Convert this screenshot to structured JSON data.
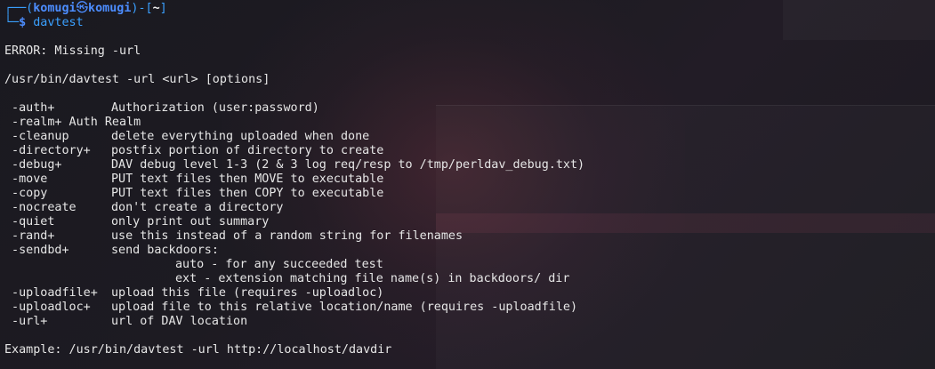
{
  "theme": {
    "background": "#1b1a20",
    "text": "#e6e6e6",
    "prompt_blue": "#3aa0ff",
    "prompt_user": "#4c8dff"
  },
  "prompt": {
    "frame_top_left": "┌──(",
    "user": "komugi",
    "skull_icon": "㉿",
    "host": "komugi",
    "frame_mid": ")-[",
    "cwd": "~",
    "frame_end": "]",
    "frame_bottom": "└─",
    "dollar": "$",
    "command": "davtest"
  },
  "output": {
    "error": "ERROR: Missing -url",
    "usage": "/usr/bin/davtest -url <url> [options]",
    "options": [
      {
        "flag": " -auth+",
        "desc": "Authorization (user:password)"
      },
      {
        "flag": " -realm+ Auth Realm",
        "desc": ""
      },
      {
        "flag": " -cleanup",
        "desc": "delete everything uploaded when done"
      },
      {
        "flag": " -directory+",
        "desc": "postfix portion of directory to create"
      },
      {
        "flag": " -debug+",
        "desc": "DAV debug level 1-3 (2 & 3 log req/resp to /tmp/perldav_debug.txt)"
      },
      {
        "flag": " -move",
        "desc": "PUT text files then MOVE to executable"
      },
      {
        "flag": " -copy",
        "desc": "PUT text files then COPY to executable"
      },
      {
        "flag": " -nocreate",
        "desc": "don't create a directory"
      },
      {
        "flag": " -quiet",
        "desc": "only print out summary"
      },
      {
        "flag": " -rand+",
        "desc": "use this instead of a random string for filenames"
      },
      {
        "flag": " -sendbd+",
        "desc": "send backdoors:"
      }
    ],
    "sendbd_sub": [
      "auto - for any succeeded test",
      "ext - extension matching file name(s) in backdoors/ dir"
    ],
    "options_after": [
      {
        "flag": " -uploadfile+",
        "desc": "upload this file (requires -uploadloc)"
      },
      {
        "flag": " -uploadloc+",
        "desc": "upload file to this relative location/name (requires -uploadfile)"
      },
      {
        "flag": " -url+",
        "desc": "url of DAV location"
      }
    ],
    "example": "Example: /usr/bin/davtest -url http://localhost/davdir"
  }
}
